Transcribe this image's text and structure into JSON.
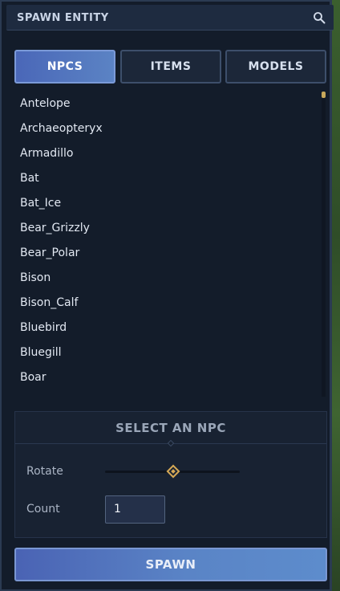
{
  "header": {
    "title": "SPAWN ENTITY",
    "search_icon": "search-icon"
  },
  "tabs": [
    {
      "label": "NPCS",
      "active": true
    },
    {
      "label": "ITEMS",
      "active": false
    },
    {
      "label": "MODELS",
      "active": false
    }
  ],
  "list": {
    "items": [
      "Antelope",
      "Archaeopteryx",
      "Armadillo",
      "Bat",
      "Bat_Ice",
      "Bear_Grizzly",
      "Bear_Polar",
      "Bison",
      "Bison_Calf",
      "Bluebird",
      "Bluegill",
      "Boar"
    ]
  },
  "detail": {
    "title": "SELECT AN NPC",
    "rotate_label": "Rotate",
    "rotate_value": 0.5,
    "count_label": "Count",
    "count_value": "1"
  },
  "spawn_button": {
    "label": "SPAWN"
  },
  "colors": {
    "panel_bg": "#131c2a",
    "accent_blue": "#5b83c4",
    "slider_gold": "#d6a956"
  }
}
